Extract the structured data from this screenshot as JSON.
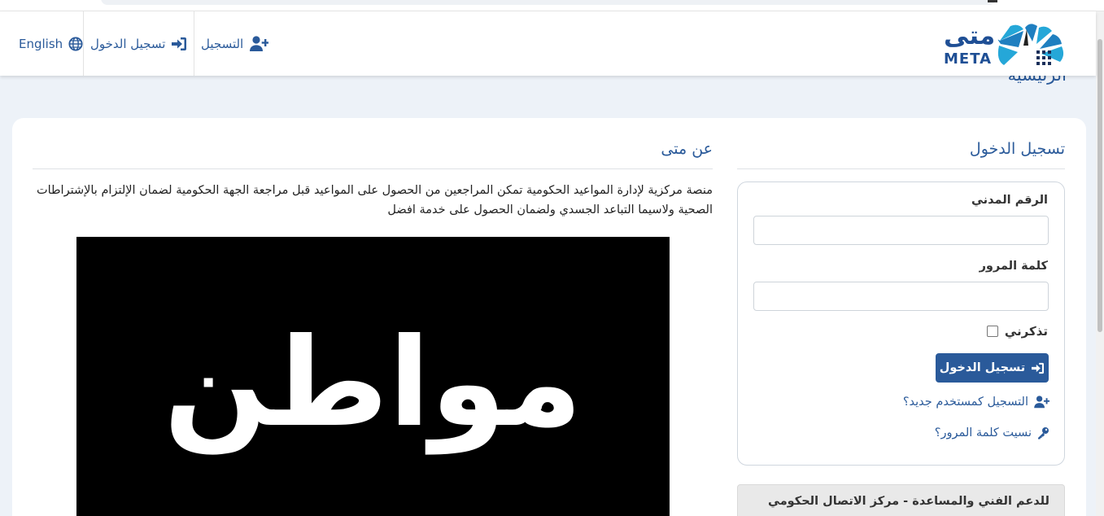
{
  "header": {
    "language_label": "English",
    "login_label": "تسجيل الدخول",
    "register_label": "التسجيل",
    "logo_arabic": "متى",
    "logo_latin": "META"
  },
  "breadcrumb": {
    "current": "الرئيسية"
  },
  "about": {
    "title": "عن متى",
    "description": "منصة مركزية لإدارة المواعيد الحكومية تمكن المراجعين من الحصول على المواعيد قبل مراجعة الجهة الحكومية لضمان الإلتزام بالإشتراطات الصحية ولاسيما التباعد الجسدي ولضمان الحصول على خدمة افضل",
    "banner_text": "مواطن"
  },
  "login": {
    "title": "تسجيل الدخول",
    "civil_id_label": "الرقم المدني",
    "civil_id_value": "",
    "password_label": "كلمة المرور",
    "password_value": "",
    "remember_label": "تذكرني",
    "remember_checked": false,
    "submit_label": "تسجيل الدخول",
    "register_link": "التسجيل كمستخدم جديد؟",
    "forgot_link": "نسيت كلمة المرور؟"
  },
  "support": {
    "title": "للدعم الفني والمساعدة - مركز الاتصال الحكومي"
  },
  "colors": {
    "brand_blue": "#2a5a9a",
    "logo_cyan": "#25a7d8",
    "page_bg": "#edf2f8"
  }
}
